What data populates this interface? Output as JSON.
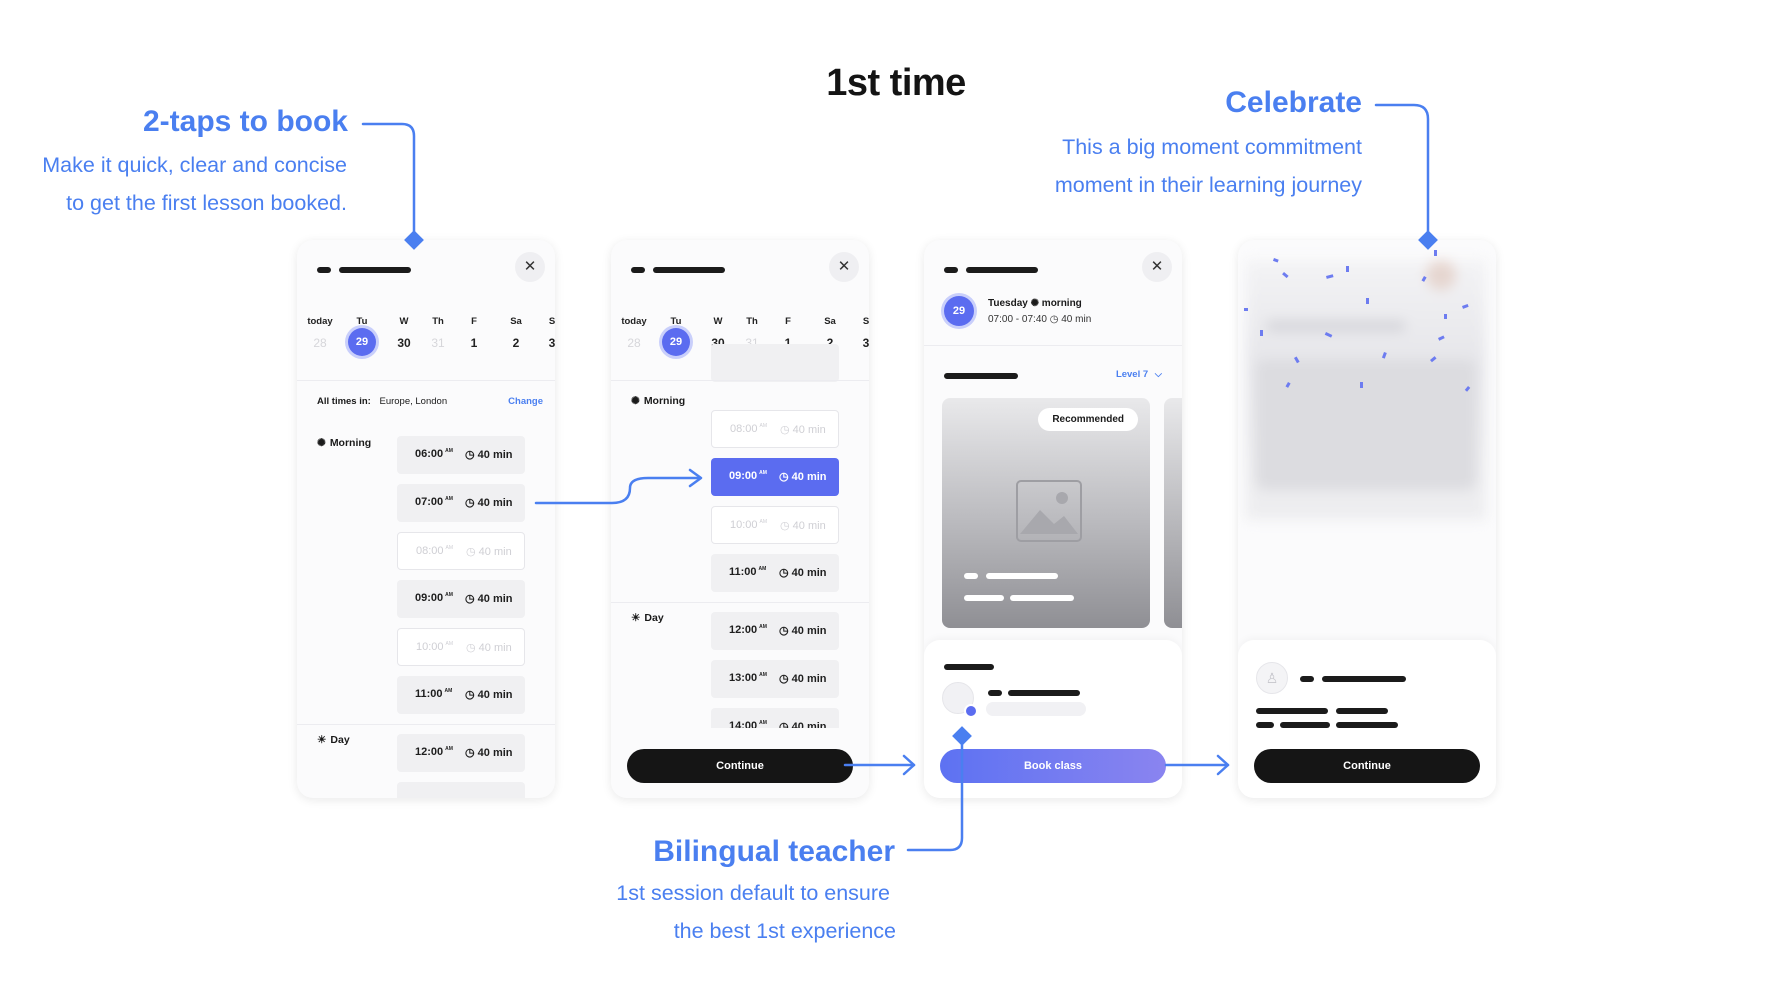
{
  "title": "1st time",
  "annotations": {
    "two_taps": {
      "heading": "2-taps to book",
      "line1": "Make it quick, clear and concise",
      "line2": "to get the first lesson booked."
    },
    "celebrate": {
      "heading": "Celebrate",
      "line1": "This a big moment commitment",
      "line2": "moment in their learning journey"
    },
    "bilingual": {
      "heading": "Bilingual teacher",
      "line1": "1st session default to ensure",
      "line2": "the best 1st experience"
    }
  },
  "calendar": {
    "day_names": [
      "today",
      "Tu",
      "W",
      "Th",
      "F",
      "Sa",
      "S"
    ],
    "dates": [
      "28",
      "29",
      "30",
      "31",
      "1",
      "2",
      "3"
    ],
    "selected_date": "29"
  },
  "timezone": {
    "label": "All times in:",
    "value": "Europe, London",
    "change": "Change"
  },
  "sections": {
    "morning": "Morning",
    "day": "Day"
  },
  "duration": "40 min",
  "am": "AM",
  "screen1_slots": [
    {
      "time": "06:00",
      "state": "available"
    },
    {
      "time": "07:00",
      "state": "available"
    },
    {
      "time": "08:00",
      "state": "unavailable"
    },
    {
      "time": "09:00",
      "state": "available"
    },
    {
      "time": "10:00",
      "state": "unavailable"
    },
    {
      "time": "11:00",
      "state": "available"
    },
    {
      "time": "12:00",
      "state": "available"
    }
  ],
  "screen2_slots": [
    {
      "time": "08:00",
      "state": "unavailable"
    },
    {
      "time": "09:00",
      "state": "selected"
    },
    {
      "time": "10:00",
      "state": "unavailable"
    },
    {
      "time": "11:00",
      "state": "available"
    },
    {
      "time": "12:00",
      "state": "available"
    },
    {
      "time": "13:00",
      "state": "available"
    },
    {
      "time": "14:00",
      "state": "available"
    }
  ],
  "screen3": {
    "date_badge": "29",
    "day_label": "Tuesday",
    "period": "morning",
    "time_range": "07:00 - 07:40",
    "duration": "40 min",
    "level": "Level 7",
    "badge": "Recommended",
    "cta": "Book class"
  },
  "buttons": {
    "continue": "Continue"
  },
  "colors": {
    "accent": "#4a7ff0",
    "brand": "#5b6cf0",
    "dark": "#151515"
  },
  "icons": {
    "close": "close-icon",
    "clock": "clock-icon",
    "morning": "sunrise-icon",
    "day": "sun-icon",
    "image": "image-placeholder-icon",
    "avatar": "avatar-icon",
    "chevron": "chevron-down-icon"
  }
}
